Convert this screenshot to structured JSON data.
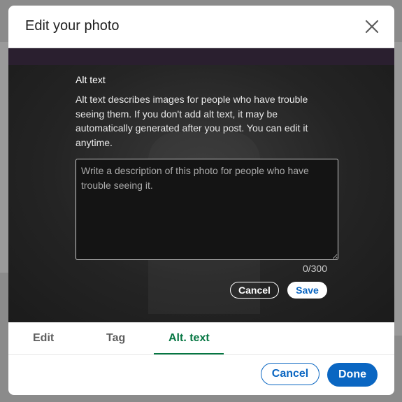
{
  "modal": {
    "title": "Edit your photo"
  },
  "alt_text_panel": {
    "label": "Alt text",
    "description": "Alt text describes images for people who have trouble seeing them. If you don't add alt text, it may be automatically generated after you post. You can edit it anytime.",
    "textarea_value": "",
    "textarea_placeholder": "Write a description of this photo for people who have trouble seeing it.",
    "char_count": "0/300",
    "cancel_label": "Cancel",
    "save_label": "Save"
  },
  "tabs": [
    {
      "label": "Edit",
      "active": false
    },
    {
      "label": "Tag",
      "active": false
    },
    {
      "label": "Alt. text",
      "active": true
    }
  ],
  "footer": {
    "cancel_label": "Cancel",
    "done_label": "Done"
  },
  "icons": {
    "close": "close-icon"
  },
  "colors": {
    "primary_blue": "#0a66c2",
    "active_tab_green": "#057642",
    "overlay_bg": "#1b1b1b"
  }
}
